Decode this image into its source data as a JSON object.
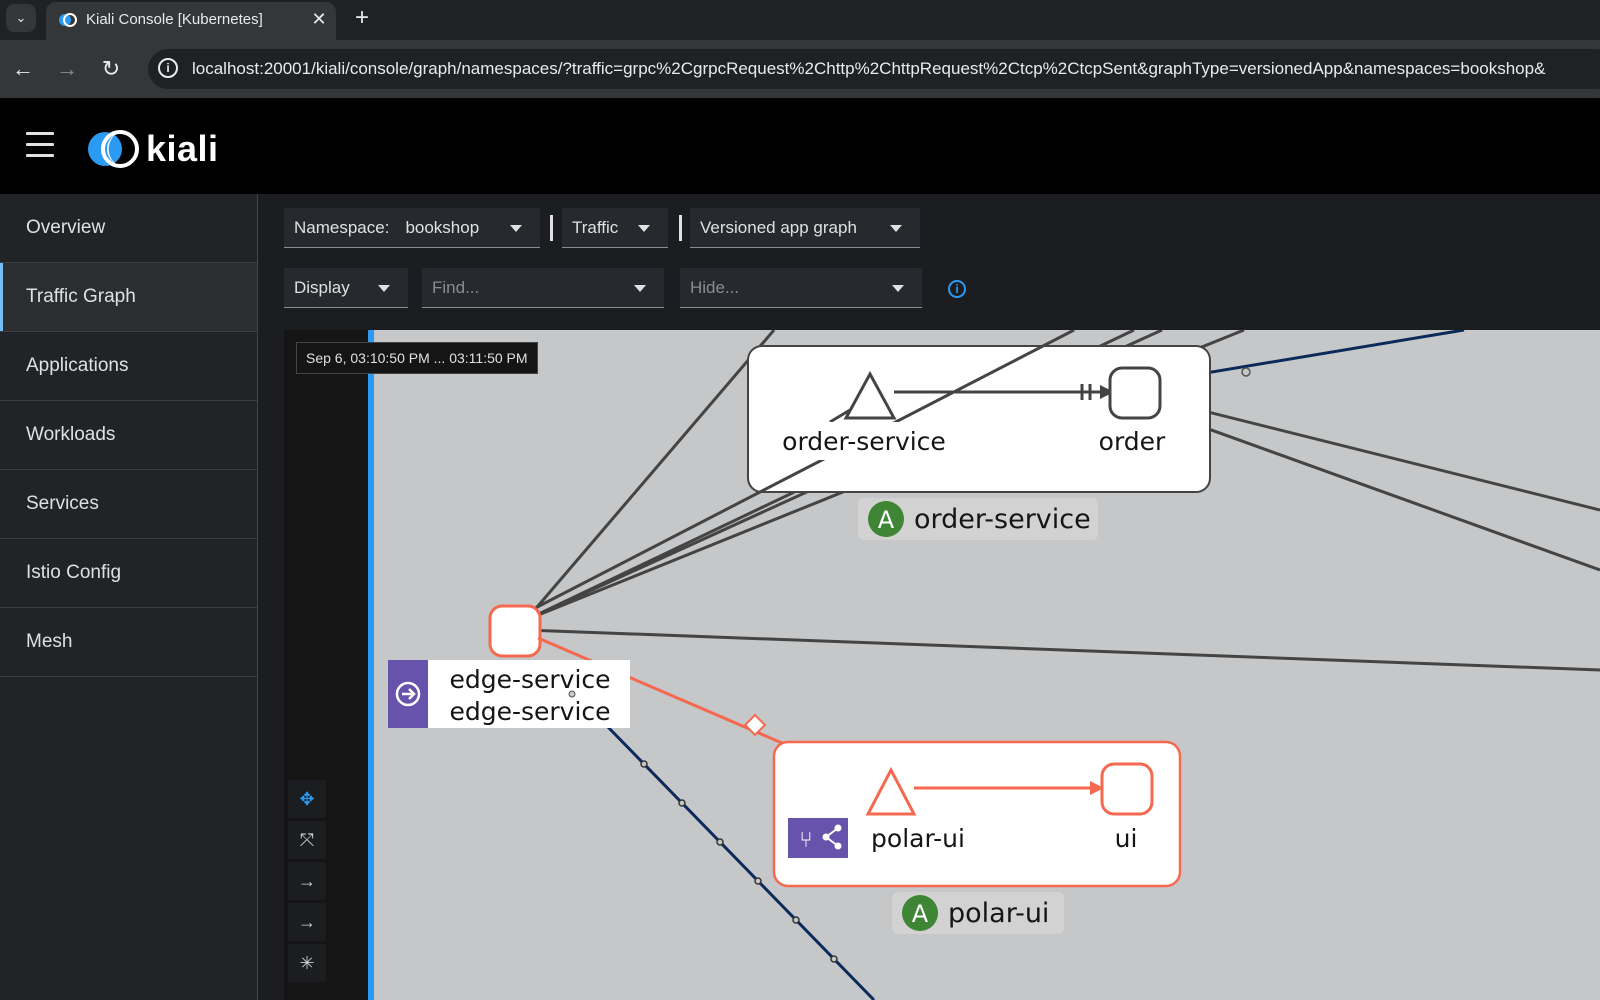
{
  "browser": {
    "tab_title": "Kiali Console [Kubernetes]",
    "tab_close": "✕",
    "new_tab": "+",
    "url": "localhost:20001/kiali/console/graph/namespaces/?traffic=grpc%2CgrpcRequest%2Chttp%2ChttpRequest%2Ctcp%2CtcpSent&graphType=versionedApp&namespaces=bookshop&"
  },
  "app": {
    "logo_text": "kiali"
  },
  "sidebar": {
    "items": [
      {
        "label": "Overview"
      },
      {
        "label": "Traffic Graph"
      },
      {
        "label": "Applications"
      },
      {
        "label": "Workloads"
      },
      {
        "label": "Services"
      },
      {
        "label": "Istio Config"
      },
      {
        "label": "Mesh"
      }
    ]
  },
  "filters": {
    "namespace_label": "Namespace:",
    "namespace_value": "bookshop",
    "traffic": "Traffic",
    "graph_type": "Versioned app graph",
    "display": "Display",
    "find_placeholder": "Find...",
    "hide_placeholder": "Hide..."
  },
  "graph": {
    "time_range": "Sep 6, 03:10:50 PM ... 03:11:50 PM",
    "nodes": {
      "order_service_service": "order-service",
      "order_workload": "order",
      "order_app_badge": "A",
      "order_app_name": "order-service",
      "edge_service_line1": "edge-service",
      "edge_service_line2": "edge-service",
      "polar_ui_service": "polar-ui",
      "ui_workload": "ui",
      "polar_app_badge": "A",
      "polar_app_name": "polar-ui"
    },
    "colors": {
      "error_edge": "#f4694f",
      "tcp_edge": "#0a2a5a",
      "healthy_edge": "#444444",
      "app_badge": "#3e8635",
      "virtual_service": "#6753ac"
    }
  }
}
